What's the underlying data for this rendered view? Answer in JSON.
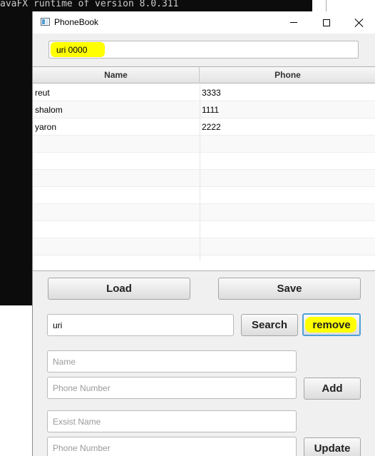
{
  "console": {
    "text": "avaFX runtime of version 8.0.311"
  },
  "window": {
    "title": "PhoneBook",
    "icon": "app-window-icon",
    "controls": [
      "minimize-icon",
      "maximize-icon",
      "close-icon"
    ]
  },
  "top_field": {
    "value": "uri 0000"
  },
  "table": {
    "columns": [
      "Name",
      "Phone"
    ],
    "rows": [
      {
        "name": "reut",
        "phone": "3333"
      },
      {
        "name": "shalom",
        "phone": "1111"
      },
      {
        "name": "yaron",
        "phone": "2222"
      }
    ]
  },
  "buttons": {
    "load": "Load",
    "save": "Save",
    "search": "Search",
    "remove": "remove",
    "add": "Add",
    "update": "Update"
  },
  "inputs": {
    "search_value": "uri",
    "name_placeholder": "Name",
    "phone_placeholder": "Phone Number",
    "exist_placeholder": "Exsist Name",
    "phone2_placeholder": "Phone Number"
  },
  "colors": {
    "highlight": "#ffff00",
    "focus_border": "#4fa0d9",
    "console_bg": "#0c0c0c"
  }
}
